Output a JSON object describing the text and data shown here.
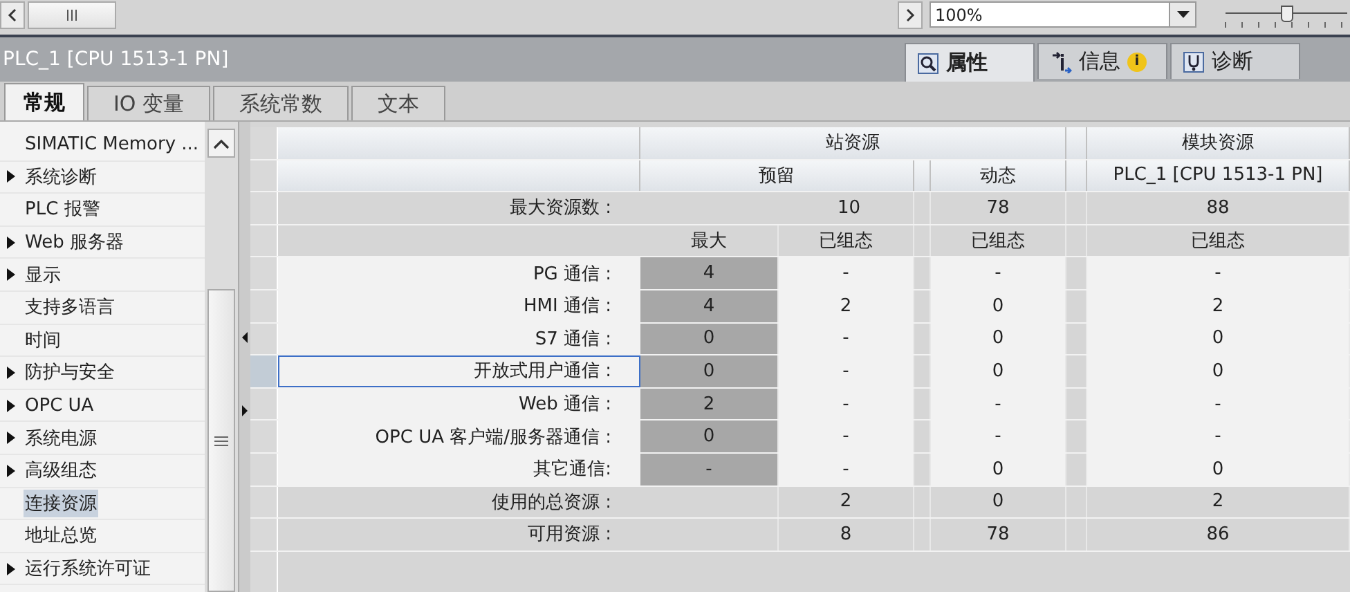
{
  "toolbar": {
    "zoom": "100%",
    "zoom_slider": {
      "level": 0.5
    }
  },
  "inspector": {
    "title": "PLC_1 [CPU 1513-1 PN]",
    "tabs": [
      {
        "label": "属性",
        "selected": true
      },
      {
        "label": "信息",
        "badge": "i",
        "selected": false
      },
      {
        "label": "诊断",
        "selected": false
      }
    ]
  },
  "tabs": [
    {
      "label": "常规",
      "selected": true
    },
    {
      "label": "IO 变量",
      "selected": false
    },
    {
      "label": "系统常数",
      "selected": false
    },
    {
      "label": "文本",
      "selected": false
    }
  ],
  "sidebar": {
    "items": [
      {
        "label": "SIMATIC Memory ...",
        "expandable": false,
        "selected": false
      },
      {
        "label": "系统诊断",
        "expandable": true,
        "selected": false
      },
      {
        "label": "PLC 报警",
        "expandable": false,
        "selected": false
      },
      {
        "label": "Web 服务器",
        "expandable": true,
        "selected": false
      },
      {
        "label": "显示",
        "expandable": true,
        "selected": false
      },
      {
        "label": "支持多语言",
        "expandable": false,
        "selected": false
      },
      {
        "label": "时间",
        "expandable": false,
        "selected": false
      },
      {
        "label": "防护与安全",
        "expandable": true,
        "selected": false
      },
      {
        "label": "OPC UA",
        "expandable": true,
        "selected": false
      },
      {
        "label": "系统电源",
        "expandable": true,
        "selected": false
      },
      {
        "label": "高级组态",
        "expandable": true,
        "selected": false
      },
      {
        "label": "连接资源",
        "expandable": false,
        "selected": true
      },
      {
        "label": "地址总览",
        "expandable": false,
        "selected": false
      },
      {
        "label": "运行系统许可证",
        "expandable": true,
        "selected": false
      }
    ]
  },
  "table": {
    "header": {
      "station": "站资源",
      "module": "模块资源",
      "reserved": "预留",
      "dynamic": "动态",
      "module_name": "PLC_1 [CPU 1513-1 PN]"
    },
    "rows": [
      {
        "kind": "limit",
        "label": "最大资源数 :",
        "reserved": "10",
        "dynamic": "78",
        "module": "88",
        "focused": false
      },
      {
        "kind": "subhead",
        "max": "最大",
        "reserved": "已组态",
        "dynamic": "已组态",
        "module": "已组态",
        "focused": false
      },
      {
        "kind": "comm",
        "label": "PG 通信 :",
        "max": "4",
        "reserved": "-",
        "dynamic": "-",
        "module": "-",
        "focused": false
      },
      {
        "kind": "comm",
        "label": "HMI 通信 :",
        "max": "4",
        "reserved": "2",
        "dynamic": "0",
        "module": "2",
        "focused": false
      },
      {
        "kind": "comm",
        "label": "S7 通信 :",
        "max": "0",
        "reserved": "-",
        "dynamic": "0",
        "module": "0",
        "focused": false
      },
      {
        "kind": "comm",
        "label": "开放式用户通信 :",
        "max": "0",
        "reserved": "-",
        "dynamic": "0",
        "module": "0",
        "focused": true
      },
      {
        "kind": "comm",
        "label": "Web 通信 :",
        "max": "2",
        "reserved": "-",
        "dynamic": "-",
        "module": "-",
        "focused": false
      },
      {
        "kind": "comm",
        "label": "OPC UA 客户端/服务器通信 :",
        "max": "0",
        "reserved": "-",
        "dynamic": "-",
        "module": "-",
        "focused": false
      },
      {
        "kind": "comm",
        "label": "其它通信:",
        "max": "-",
        "reserved": "-",
        "dynamic": "0",
        "module": "0",
        "focused": false
      },
      {
        "kind": "sum",
        "label": "使用的总资源 :",
        "reserved": "2",
        "dynamic": "0",
        "module": "2",
        "focused": false
      },
      {
        "kind": "sum",
        "label": "可用资源 :",
        "reserved": "8",
        "dynamic": "78",
        "module": "86",
        "focused": false
      }
    ]
  }
}
